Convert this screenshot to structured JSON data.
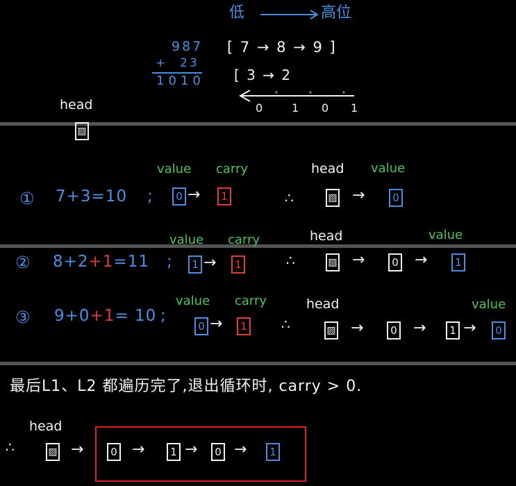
{
  "top": {
    "direction_low": "低",
    "direction_high": "高位",
    "sum_top": "987",
    "sum_plus": "+",
    "sum_addend": "23",
    "sum_result": "1010",
    "list1": "[ 7 → 8 → 9 ]",
    "list2": "[ 3 → 2",
    "result_digits": [
      "0",
      "1",
      "0",
      "1"
    ],
    "head_label": "head",
    "head_symbol": "▨"
  },
  "steps": [
    {
      "num": "①",
      "eq_pre": "7+3=10",
      "eq_red": "",
      "eq_post": "",
      "colon": ";",
      "value_label": "value",
      "carry_label": "carry",
      "value": "0",
      "carry": "1",
      "head_label": "head",
      "right_value_label": "value",
      "chain": [
        "0"
      ]
    },
    {
      "num": "②",
      "eq_pre": "8+2",
      "eq_red": "+1",
      "eq_post": "=11",
      "colon": ";",
      "value_label": "value",
      "carry_label": "carry",
      "value": "1",
      "carry": "1",
      "head_label": "head",
      "right_value_label": "value",
      "chain": [
        "0",
        "1"
      ]
    },
    {
      "num": "③",
      "eq_pre": "9+0",
      "eq_red": "+1",
      "eq_post": "= 10",
      "colon": ";",
      "value_label": "value",
      "carry_label": "carry",
      "value": "0",
      "carry": "1",
      "head_label": "head",
      "right_value_label": "value",
      "chain": [
        "0",
        "1",
        "0"
      ]
    }
  ],
  "final": {
    "note": "最后L1、L2 都遍历完了,退出循环时, carry > 0.",
    "head_label": "head",
    "chain": [
      "0",
      "1",
      "0",
      "1"
    ]
  },
  "symbols": {
    "arrow": "→",
    "therefore": "∴"
  }
}
